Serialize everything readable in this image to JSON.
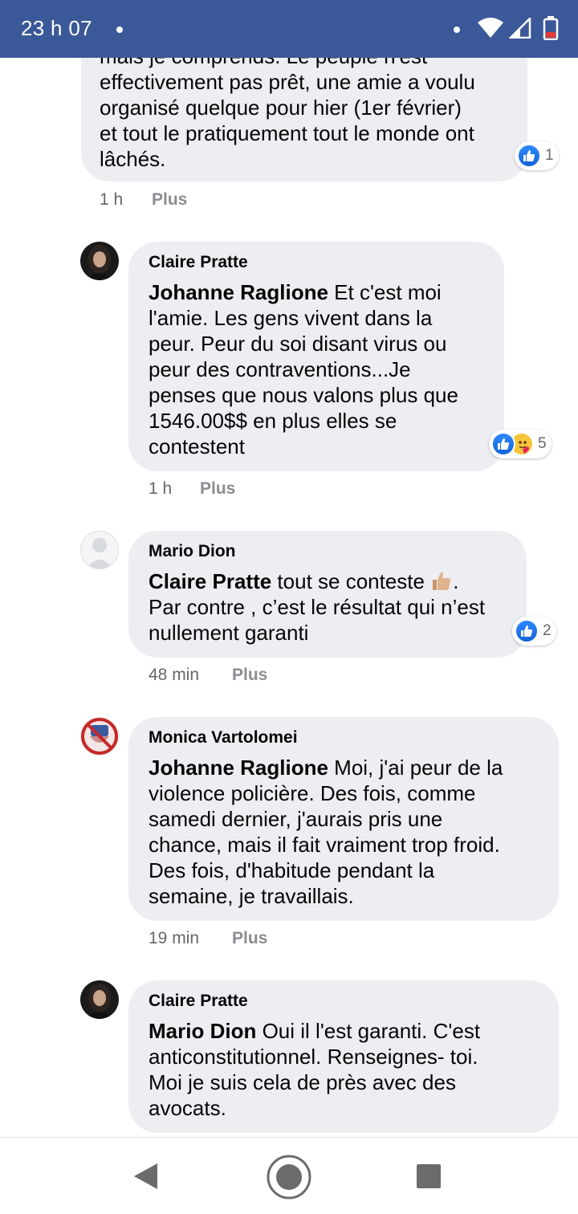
{
  "status_bar": {
    "time": "23 h 07",
    "background": "#3b5998"
  },
  "comments": [
    {
      "author": "",
      "mention": "",
      "partial_line": "mais je comprends. Le peuple n'est",
      "text": "effectivement pas prêt, une amie a voulu organisé quelque pour hier (1er février) et tout le pratiquement tout le monde ont lâchés.",
      "lines": [
        "effectivement pas prêt, une amie a voulu",
        "organisé quelque pour hier (1er février)",
        "et tout le pratiquement tout le monde ont",
        "lâchés."
      ],
      "time": "1 h",
      "more": "Plus",
      "reactions": {
        "icons": [
          "like-icon"
        ],
        "count": "1"
      }
    },
    {
      "author": "Claire Pratte",
      "mention": "Johanne Raglione",
      "lines": [
        "Et c'est moi",
        "l'amie. Les gens vivent dans la",
        "peur. Peur du soi disant virus ou",
        "peur des contraventions...Je",
        "penses que nous valons plus que",
        "1546.00$$ en plus elles se",
        "contestent"
      ],
      "time": "1 h",
      "more": "Plus",
      "reactions": {
        "icons": [
          "like-icon",
          "care-icon"
        ],
        "count": "5"
      }
    },
    {
      "author": "Mario Dion",
      "mention": "Claire Pratte",
      "lines": [
        "tout se conteste",
        ".",
        "Par contre , c’est le résultat qui n’est",
        "nullement garanti"
      ],
      "emoji": "thumbs-up-emoji",
      "time": "48 min",
      "more": "Plus",
      "reactions": {
        "icons": [
          "like-icon"
        ],
        "count": "2"
      }
    },
    {
      "author": "Monica Vartolomei",
      "mention": "Johanne Raglione",
      "lines": [
        "Moi, j'ai peur de la",
        "violence policière. Des fois, comme",
        "samedi dernier, j'aurais pris une",
        "chance, mais il fait vraiment trop froid.",
        "Des fois, d'habitude pendant la",
        "semaine, je travaillais."
      ],
      "time": "19 min",
      "more": "Plus"
    },
    {
      "author": "Claire Pratte",
      "mention": "Mario Dion",
      "lines": [
        "Oui il l'est garanti. C'est",
        "anticonstitutionnel. Renseignes- toi.",
        "Moi je suis cela de près avec des",
        "avocats."
      ]
    }
  ],
  "colors": {
    "bubble": "#eceef2",
    "meta": "#65676b",
    "like_blue": "#1877f2"
  }
}
